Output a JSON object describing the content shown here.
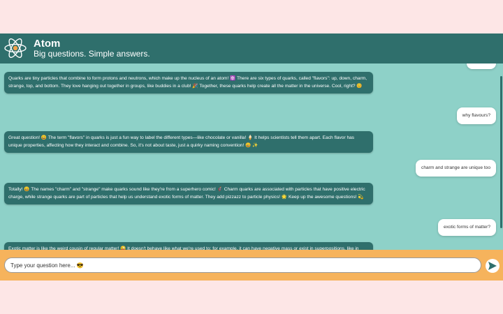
{
  "header": {
    "title": "Atom",
    "subtitle": "Big questions. Simple answers."
  },
  "messages": [
    {
      "role": "bot",
      "text": "Quarks are tiny particles that combine to form protons and neutrons, which make up the nucleus of an atom! ⚛️ There are six types of quarks, called \"flavors\": up, down, charm, strange, top, and bottom. They love hanging out together in groups, like buddies in a club! 🎉 Together, these quarks help create all the matter in the universe. Cool, right? 😊"
    },
    {
      "role": "user",
      "text": "why flavours?"
    },
    {
      "role": "bot",
      "text": "Great question! 😄 The term \"flavors\" in quarks is just a fun way to label the different types—like chocolate or vanilla! 🍦 It helps scientists tell them apart. Each flavor has unique properties, affecting how they interact and combine. So, it's not about taste, just a quirky naming convention! 😄 ✨"
    },
    {
      "role": "user",
      "text": "charm and strange are unique too"
    },
    {
      "role": "bot",
      "text": "Totally! 😄 The names \"charm\" and \"strange\" make quarks sound like they're from a superhero comic! 🦸 Charm quarks are associated with particles that have positive electric charge, while strange quarks are part of particles that help us understand exotic forms of matter. They add pizzazz to particle physics! 🌟 Keep up the awesome questions! 💫"
    },
    {
      "role": "user",
      "text": "exotic forms of matter?"
    },
    {
      "role": "bot",
      "text": "Exotic matter is like the weird cousin of regular matter! 😜 It doesn't behave like what we're used to; for example, it can have negative mass or exist in superpositions, like in"
    }
  ],
  "composer": {
    "placeholder": "Type your question here... 😎"
  },
  "icons": {
    "logo": "atom-icon",
    "send": "send-icon"
  },
  "colors": {
    "header": "#2f6f6c",
    "chat_background": "#8ed1c8",
    "composer_background": "#f6b35c",
    "page_background": "#fde6e6"
  }
}
